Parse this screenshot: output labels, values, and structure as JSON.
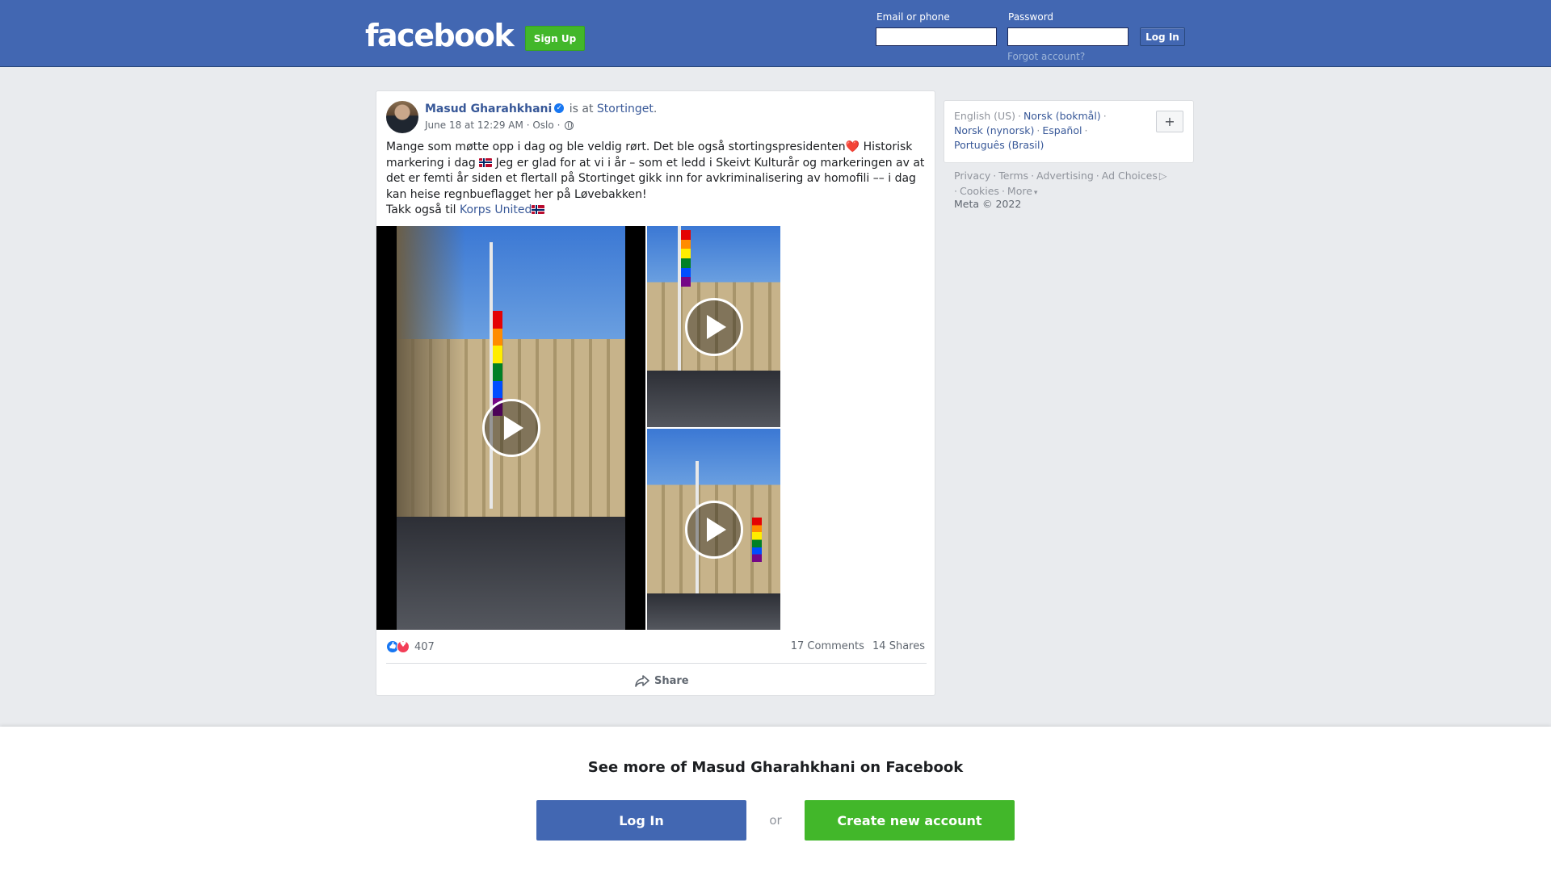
{
  "header": {
    "logo": "facebook",
    "signup_label": "Sign Up",
    "email_label": "Email or phone",
    "password_label": "Password",
    "login_label": "Log In",
    "forgot_label": "Forgot account?"
  },
  "post": {
    "author": "Masud Gharahkhani",
    "is_at": "is at",
    "location_link": "Stortinget",
    "location_period": ".",
    "date": "June 18 at 12:29 AM",
    "place": "Oslo",
    "dot": "·",
    "text_1": "Mange som møtte opp i dag og ble veldig rørt. Det ble også stortingspresidenten",
    "heart": "❤️",
    "text_2": " Historisk markering i dag ",
    "text_3": " Jeg er glad for at vi i år – som et ledd i Skeivt Kulturår og markeringen av at det er femti år siden et flertall på Stortinget gikk inn for avkriminalisering av homofili –– i dag kan heise regnbueflagget her på Løvebakken!",
    "text_4": "Takk også til ",
    "text_link": "Korps United",
    "reaction_count": "407",
    "comments": "17 Comments",
    "shares": "14 Shares",
    "share_label": "Share",
    "media": [
      {
        "type": "video",
        "icon": "play-icon"
      },
      {
        "type": "video",
        "icon": "play-icon"
      },
      {
        "type": "video",
        "icon": "play-icon"
      }
    ]
  },
  "sidebar": {
    "languages": [
      "English (US)",
      "Norsk (bokmål)",
      "Norsk (nynorsk)",
      "Español",
      "Português (Brasil)"
    ],
    "sep": "·",
    "plus": "+",
    "links": [
      "Privacy",
      "Terms",
      "Advertising",
      "Ad Choices",
      "Cookies",
      "More"
    ],
    "copyright": "Meta © 2022"
  },
  "banner": {
    "title": "See more of Masud Gharahkhani on Facebook",
    "login": "Log In",
    "or": "or",
    "create": "Create new account"
  },
  "colors": {
    "brand_blue": "#4267b2",
    "green": "#42b72a",
    "background": "#e9ebee"
  }
}
